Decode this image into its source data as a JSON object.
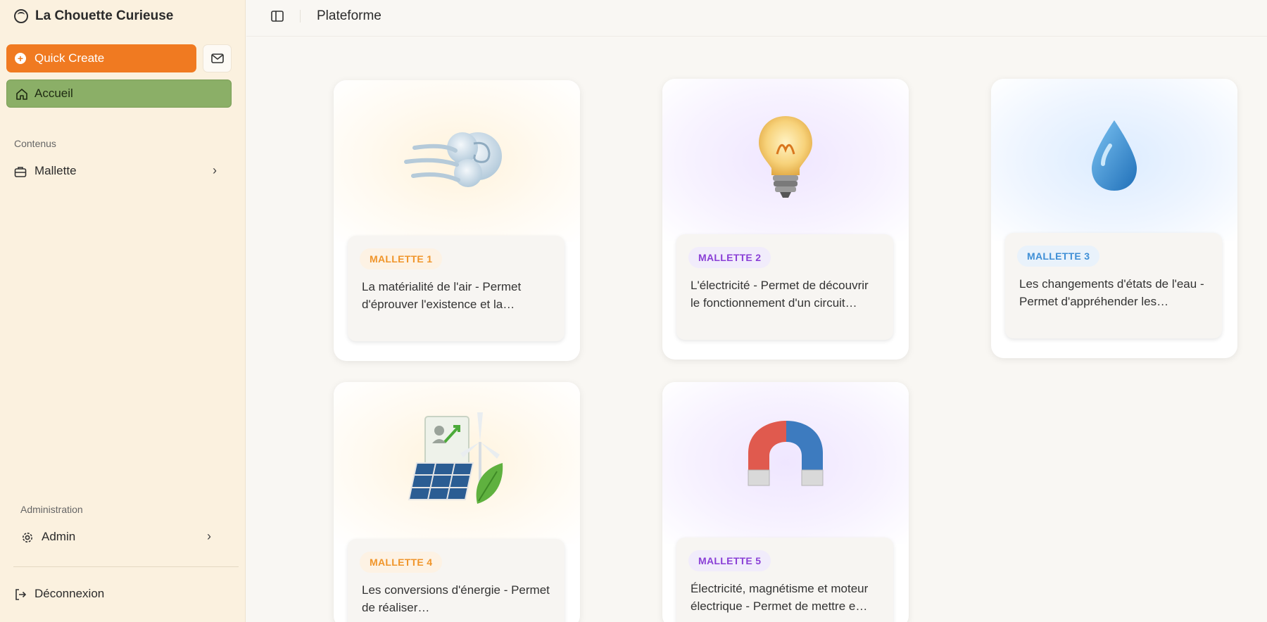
{
  "app": {
    "title": "La Chouette Curieuse"
  },
  "sidebar": {
    "quick_create": "Quick Create",
    "home": "Accueil",
    "sections": {
      "contents": "Contenus",
      "administration": "Administration"
    },
    "items": [
      {
        "label": "Mallette",
        "icon": "briefcase-icon"
      },
      {
        "label": "Admin",
        "icon": "gear-icon"
      }
    ],
    "logout": "Déconnexion"
  },
  "header": {
    "breadcrumb": "Plateforme"
  },
  "cards": [
    {
      "badge": "MALLETTE 1",
      "desc": "La matérialité de l'air - Permet d'éprouver l'existence et la…",
      "icon": "wind-icon",
      "accent": "#f0952a"
    },
    {
      "badge": "MALLETTE 2",
      "desc": "L'électricité - Permet de découvrir le fonctionnement d'un circuit…",
      "icon": "lightbulb-icon",
      "accent": "#8a3fd6"
    },
    {
      "badge": "MALLETTE 3",
      "desc": "Les changements d'états de l'eau - Permet d'appréhender les…",
      "icon": "water-drop-icon",
      "accent": "#3f8fd6"
    },
    {
      "badge": "MALLETTE 4",
      "desc": "Les conversions d'énergie - Permet de réaliser…",
      "icon": "renewable-energy-icon",
      "accent": "#f0952a"
    },
    {
      "badge": "MALLETTE 5",
      "desc": "Électricité, magnétisme et moteur électrique - Permet de mettre e…",
      "icon": "magnet-icon",
      "accent": "#8a3fd6"
    }
  ],
  "colors": {
    "sidebar_bg": "#fbf1df",
    "quick_create": "#f07a21",
    "home_active": "#8baf67",
    "page_bg": "#f9f7f3"
  }
}
